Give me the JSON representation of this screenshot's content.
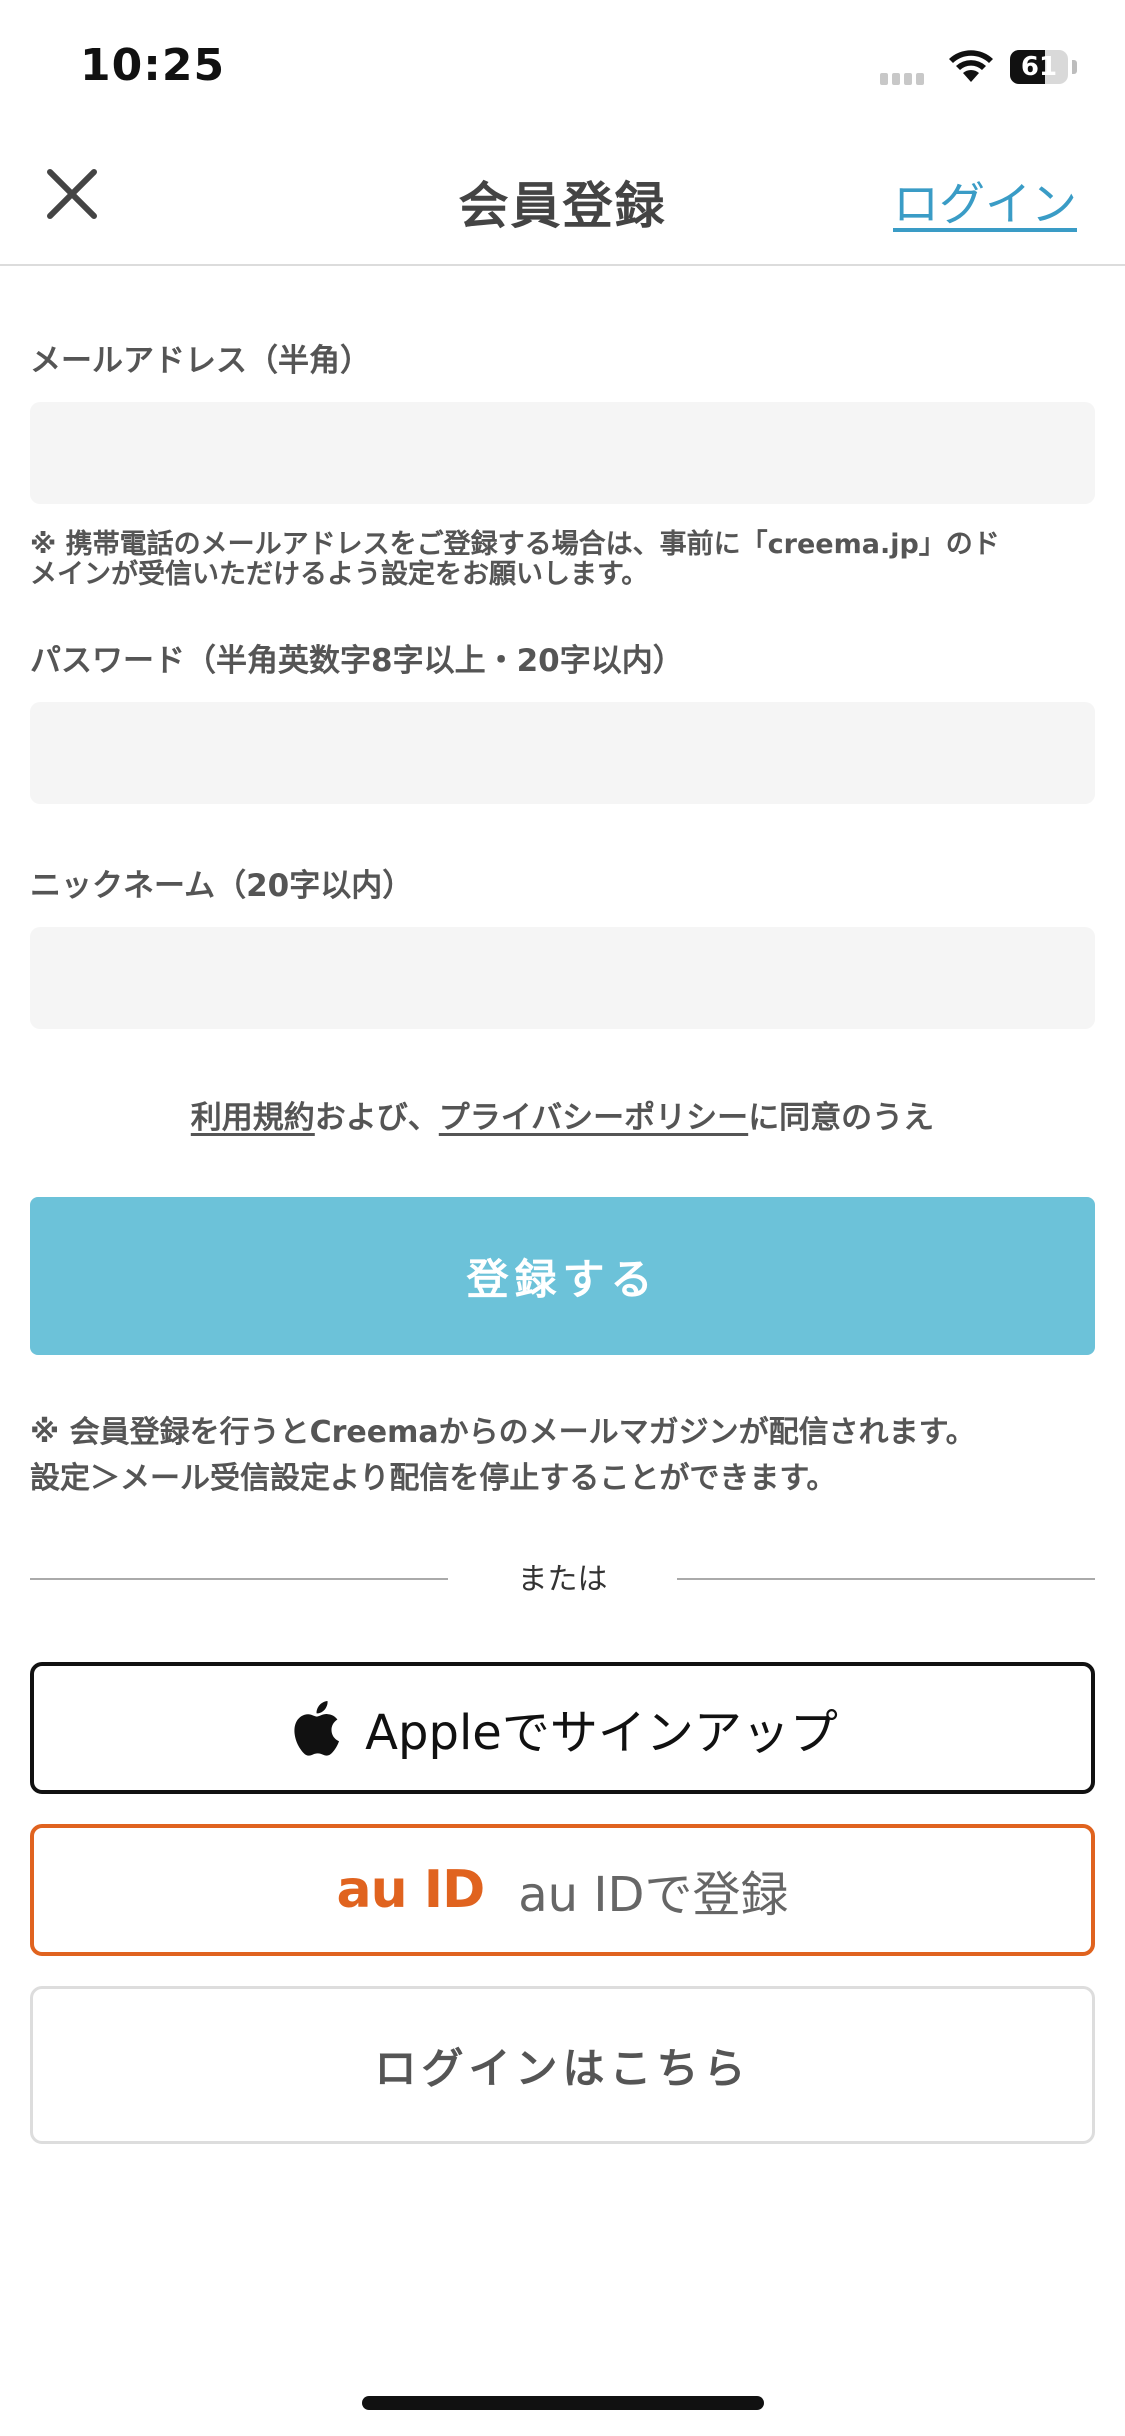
{
  "status_bar": {
    "time": "10:25",
    "battery": "61",
    "battery_level": 0.61
  },
  "nav": {
    "title": "会員登録",
    "login_link": "ログイン"
  },
  "form": {
    "email": {
      "label": "メールアドレス（半角）",
      "value": "",
      "placeholder": ""
    },
    "email_note_line1": "※ 携帯電話のメールアドレスをご登録する場合は、事前に「creema.jp」のド",
    "email_note_line2": "メインが受信いただけるよう設定をお願いします。",
    "password": {
      "label": "パスワード（半角英数字8字以上・20字以内）",
      "value": "",
      "placeholder": ""
    },
    "nickname": {
      "label": "ニックネーム（20字以内）",
      "value": "",
      "placeholder": ""
    },
    "agreement": {
      "terms_link": "利用規約",
      "and_text": "および、",
      "privacy_link": "プライバシーポリシー",
      "suffix": "に同意のうえ"
    },
    "submit_label": "登録する",
    "mail_note_line1": "※ 会員登録を行うとCreemaからのメールマガジンが配信されます。",
    "mail_note_line2": "設定＞メール受信設定より配信を停止することができます。"
  },
  "divider_text": "または",
  "social": {
    "apple_label": "Appleでサインアップ",
    "au_logo": "au ID",
    "au_label": "au IDで登録",
    "login_label": "ログインはこちら"
  },
  "colors": {
    "accent": "#6cc2d9",
    "link": "#3a9cc6",
    "au_orange": "#e0631f"
  }
}
